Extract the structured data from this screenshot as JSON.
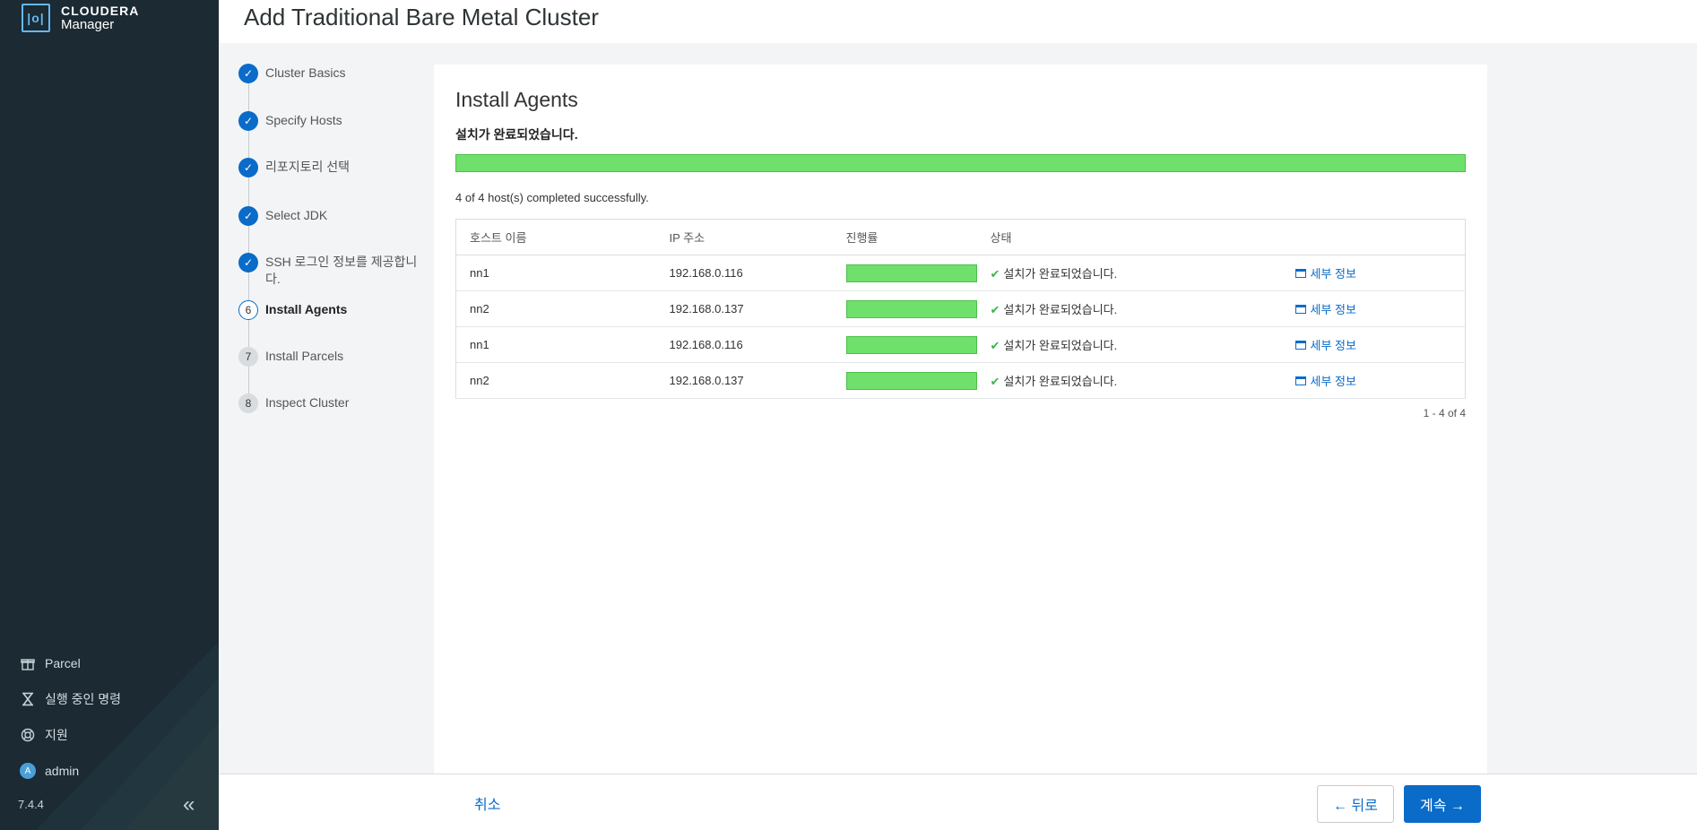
{
  "brand": {
    "name": "CLOUDERA",
    "product": "Manager",
    "mark": "|o|"
  },
  "header": {
    "title": "Add Traditional Bare Metal Cluster"
  },
  "steps": [
    {
      "num": "1",
      "label": "Cluster Basics",
      "state": "done"
    },
    {
      "num": "2",
      "label": "Specify Hosts",
      "state": "done"
    },
    {
      "num": "3",
      "label": "리포지토리 선택",
      "state": "done"
    },
    {
      "num": "4",
      "label": "Select JDK",
      "state": "done"
    },
    {
      "num": "5",
      "label": "SSH 로그인 정보를 제공합니다.",
      "state": "done"
    },
    {
      "num": "6",
      "label": "Install Agents",
      "state": "active"
    },
    {
      "num": "7",
      "label": "Install Parcels",
      "state": "todo"
    },
    {
      "num": "8",
      "label": "Inspect Cluster",
      "state": "todo"
    }
  ],
  "main": {
    "title": "Install Agents",
    "status": "설치가 완료되었습니다.",
    "progress": 1.0,
    "summary": "4 of 4 host(s) completed successfully.",
    "columns": [
      "호스트 이름",
      "IP 주소",
      "진행률",
      "상태",
      ""
    ],
    "rows": [
      {
        "host": "nn1",
        "ip": "192.168.0.116",
        "progress": 1.0,
        "status": "설치가 완료되었습니다.",
        "detail": "세부 정보"
      },
      {
        "host": "nn2",
        "ip": "192.168.0.137",
        "progress": 1.0,
        "status": "설치가 완료되었습니다.",
        "detail": "세부 정보"
      },
      {
        "host": "nn1",
        "ip": "192.168.0.116",
        "progress": 1.0,
        "status": "설치가 완료되었습니다.",
        "detail": "세부 정보"
      },
      {
        "host": "nn2",
        "ip": "192.168.0.137",
        "progress": 1.0,
        "status": "설치가 완료되었습니다.",
        "detail": "세부 정보"
      }
    ],
    "pager": "1 - 4 of 4"
  },
  "sidebar": {
    "items": [
      {
        "label": "Parcel",
        "icon": "gift-icon"
      },
      {
        "label": "실행 중인 명령",
        "icon": "hourglass-icon"
      },
      {
        "label": "지원",
        "icon": "lifebuoy-icon"
      },
      {
        "label": "admin",
        "icon": "avatar",
        "initial": "A"
      }
    ],
    "version": "7.4.4",
    "collapse_glyph": "«"
  },
  "footer": {
    "cancel": "취소",
    "back": "← 뒤로",
    "next": "계속 →"
  },
  "colors": {
    "sidebar": "#1b2a33",
    "accent": "#0a6bc9",
    "progress": "#6ee06b",
    "check": "#3cb54a"
  }
}
